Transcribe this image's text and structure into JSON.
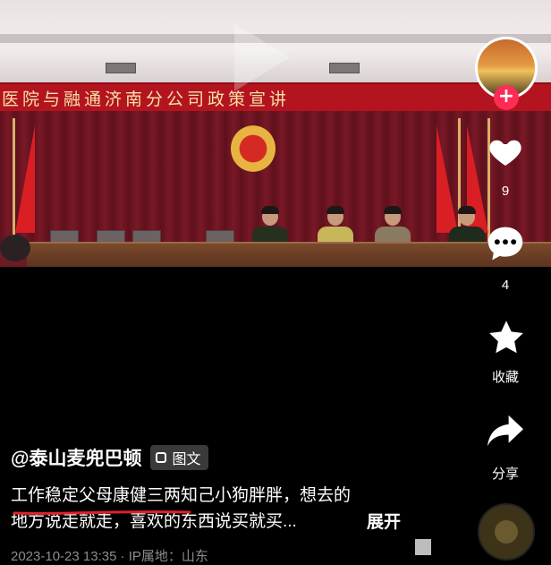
{
  "video": {
    "banner_text": "医院与融通济南分公司政策宣讲"
  },
  "rail": {
    "likes": "9",
    "comments": "4",
    "favorite_label": "收藏",
    "share_label": "分享",
    "follow_symbol": "+"
  },
  "post": {
    "author": "@泰山麦兜巴顿",
    "tag_label": "图文",
    "description_line1": "工作稳定父母康健三两知己小狗胖胖，想去的",
    "description_line2": "地方说走就走，喜欢的东西说买就买...",
    "expand_label": "展开",
    "meta": "2023-10-23 13:35 · IP属地：山东"
  },
  "colors": {
    "accent": "#fe2c55",
    "underline": "#e0202b",
    "background": "#000000"
  }
}
